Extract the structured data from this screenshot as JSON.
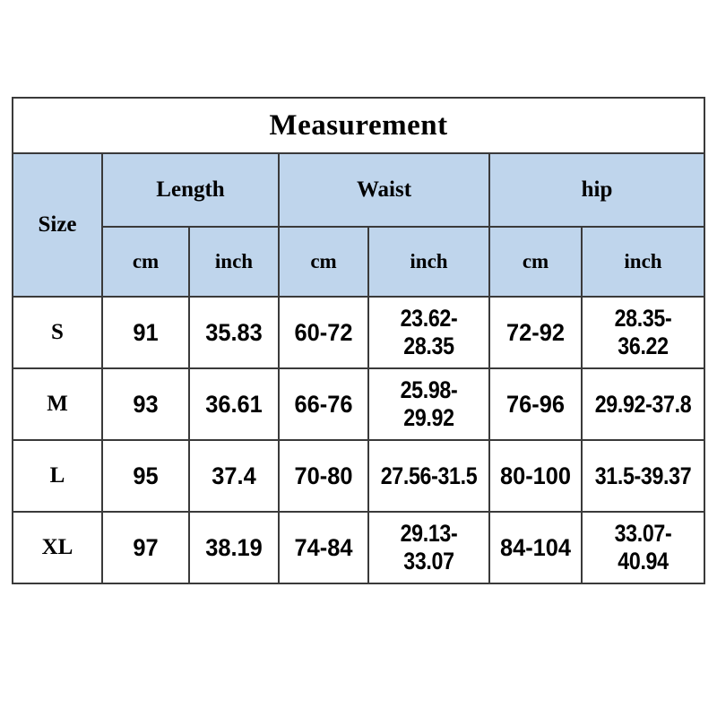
{
  "table": {
    "title": "Measurement",
    "size_header": "Size",
    "groups": [
      {
        "label": "Length",
        "units": [
          "cm",
          "inch"
        ]
      },
      {
        "label": "Waist",
        "units": [
          "cm",
          "inch"
        ]
      },
      {
        "label": "hip",
        "units": [
          "cm",
          "inch"
        ]
      }
    ],
    "rows": [
      {
        "size": "S",
        "length_cm": "91",
        "length_inch": "35.83",
        "waist_cm": "60-72",
        "waist_inch": "23.62-28.35",
        "hip_cm": "72-92",
        "hip_inch": "28.35-36.22"
      },
      {
        "size": "M",
        "length_cm": "93",
        "length_inch": "36.61",
        "waist_cm": "66-76",
        "waist_inch": "25.98-29.92",
        "hip_cm": "76-96",
        "hip_inch": "29.92-37.8"
      },
      {
        "size": "L",
        "length_cm": "95",
        "length_inch": "37.4",
        "waist_cm": "70-80",
        "waist_inch": "27.56-31.5",
        "hip_cm": "80-100",
        "hip_inch": "31.5-39.37"
      },
      {
        "size": "XL",
        "length_cm": "97",
        "length_inch": "38.19",
        "waist_cm": "74-84",
        "waist_inch": "29.13-33.07",
        "hip_cm": "84-104",
        "hip_inch": "33.07-40.94"
      }
    ]
  },
  "colors": {
    "header_fill": "#bfd5ec",
    "border": "#3a3a3a",
    "text": "#000000",
    "background": "#ffffff"
  }
}
